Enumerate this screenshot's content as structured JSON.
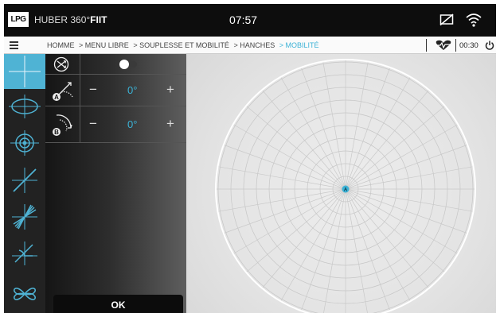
{
  "status_bar": {
    "logo": "LPG",
    "brand_light": "HUBER 360°",
    "brand_bold": "FIIT",
    "time": "07:57",
    "icons": [
      "screen-off-icon",
      "wifi-icon"
    ]
  },
  "nav": {
    "breadcrumb": [
      "HOMME",
      "> MENU LIBRE",
      "> SOUPLESSE ET MOBILITÉ",
      "> HANCHES",
      "> MOBILITÉ"
    ],
    "timer": "00:30",
    "icons": [
      "menu-icon",
      "heart-icon",
      "power-icon"
    ]
  },
  "tools": [
    {
      "name": "crosshair-tool",
      "active": true
    },
    {
      "name": "ellipse-tool",
      "active": false
    },
    {
      "name": "target-tool",
      "active": false
    },
    {
      "name": "line-tool",
      "active": false
    },
    {
      "name": "fan-tool",
      "active": false
    },
    {
      "name": "angle-tool",
      "active": false
    },
    {
      "name": "petals-tool",
      "active": false
    }
  ],
  "panel": {
    "toggle_on": false,
    "rows": [
      {
        "marker": "A",
        "minus": "−",
        "value": "0°",
        "plus": "+"
      },
      {
        "marker": "B",
        "minus": "−",
        "value": "0°",
        "plus": "+"
      }
    ],
    "ok_label": "OK"
  },
  "target": {
    "center_label": "A",
    "accent": "#3bb2d6"
  },
  "colors": {
    "accent": "#3bb2d6",
    "topbar": "#0d0d0d",
    "panel": "#2a2a2a"
  }
}
